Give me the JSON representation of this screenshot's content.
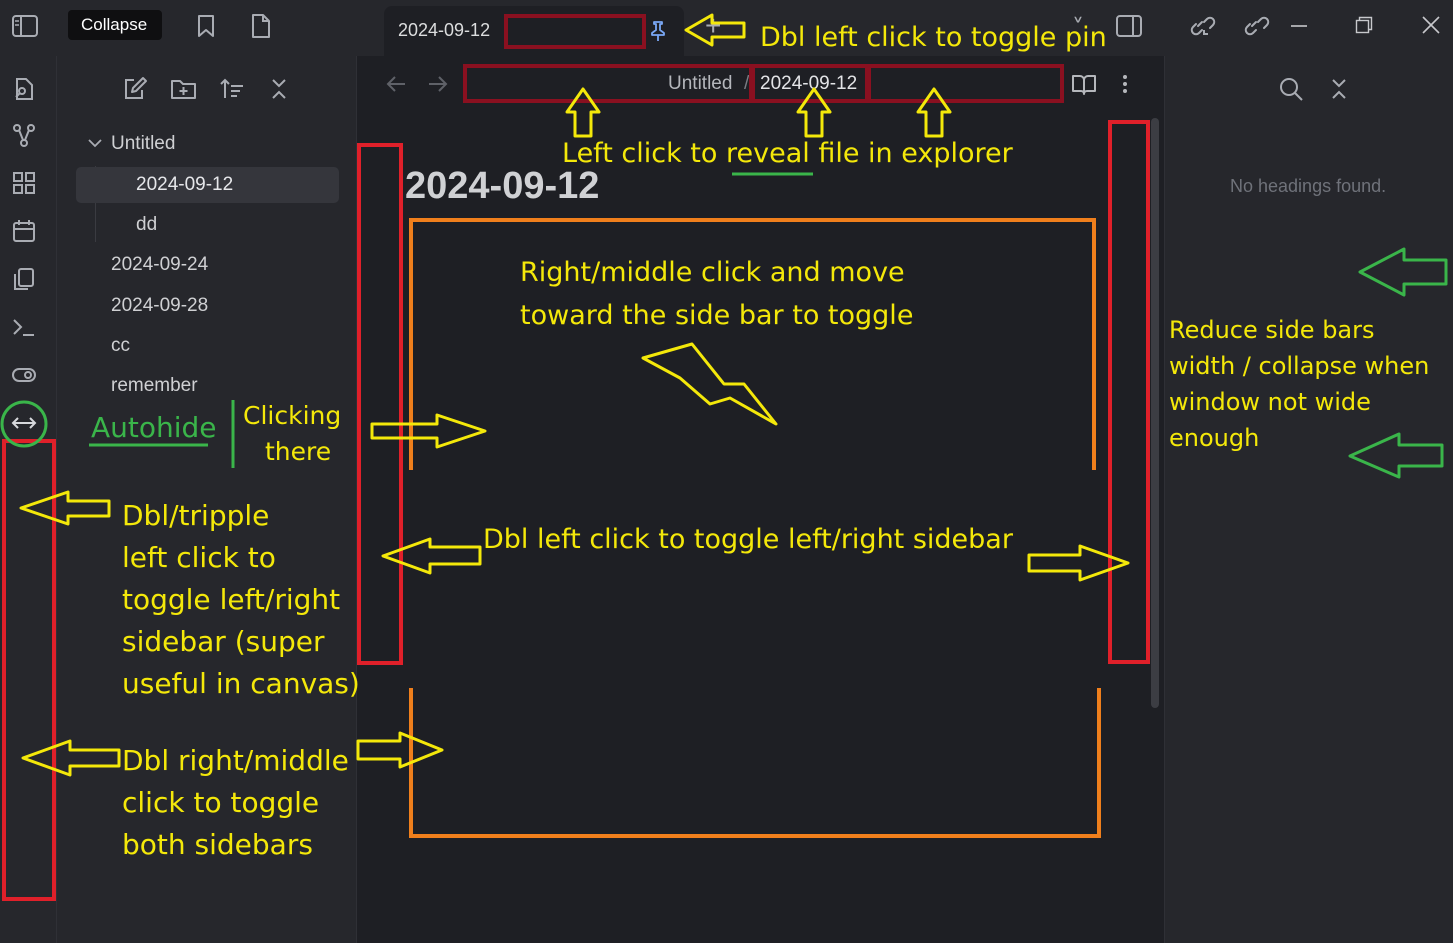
{
  "titlebar": {
    "tooltip": "Collapse",
    "tab_title": "2024-09-12",
    "new_tab": "+",
    "tab_list": "˅"
  },
  "file_explorer": {
    "items": [
      {
        "label": "Untitled"
      },
      {
        "label": "2024-09-12"
      },
      {
        "label": "dd"
      },
      {
        "label": "2024-09-24"
      },
      {
        "label": "2024-09-28"
      },
      {
        "label": "cc"
      },
      {
        "label": "remember"
      }
    ]
  },
  "editor": {
    "breadcrumb_folder": "Untitled",
    "breadcrumb_sep": "/",
    "breadcrumb_file": "2024-09-12",
    "note_title": "2024-09-12"
  },
  "outline": {
    "empty_text": "No headings found."
  },
  "annotations": {
    "dbl_click_pin": "Dbl left click to toggle pin",
    "reveal_prefix": "Left click to ",
    "reveal_word": "reveal",
    "reveal_suffix": " file in explorer",
    "right_middle_line1": "Right/middle click and move",
    "right_middle_line2": "toward the side bar to toggle",
    "dbl_left_toggle": "Dbl left click to toggle left/right sidebar",
    "autohide": "Autohide",
    "clicking_line1": "Clicking",
    "clicking_line2": "there",
    "tripple_lines": [
      "Dbl/tripple",
      "left click to",
      "toggle left/right",
      "sidebar (super",
      "useful in canvas)"
    ],
    "dbl_right_lines": [
      "Dbl right/middle",
      "click to toggle",
      "both sidebars"
    ],
    "reduce_lines": [
      "Reduce side bars",
      "width / collapse when",
      "window not wide",
      "enough"
    ]
  },
  "colors": {
    "annotation_yellow": "#f4e80a",
    "annotation_green": "#3ab54a",
    "box_red": "#e0202a",
    "box_darkred": "#8a1020",
    "box_orange": "#f07f1c"
  }
}
